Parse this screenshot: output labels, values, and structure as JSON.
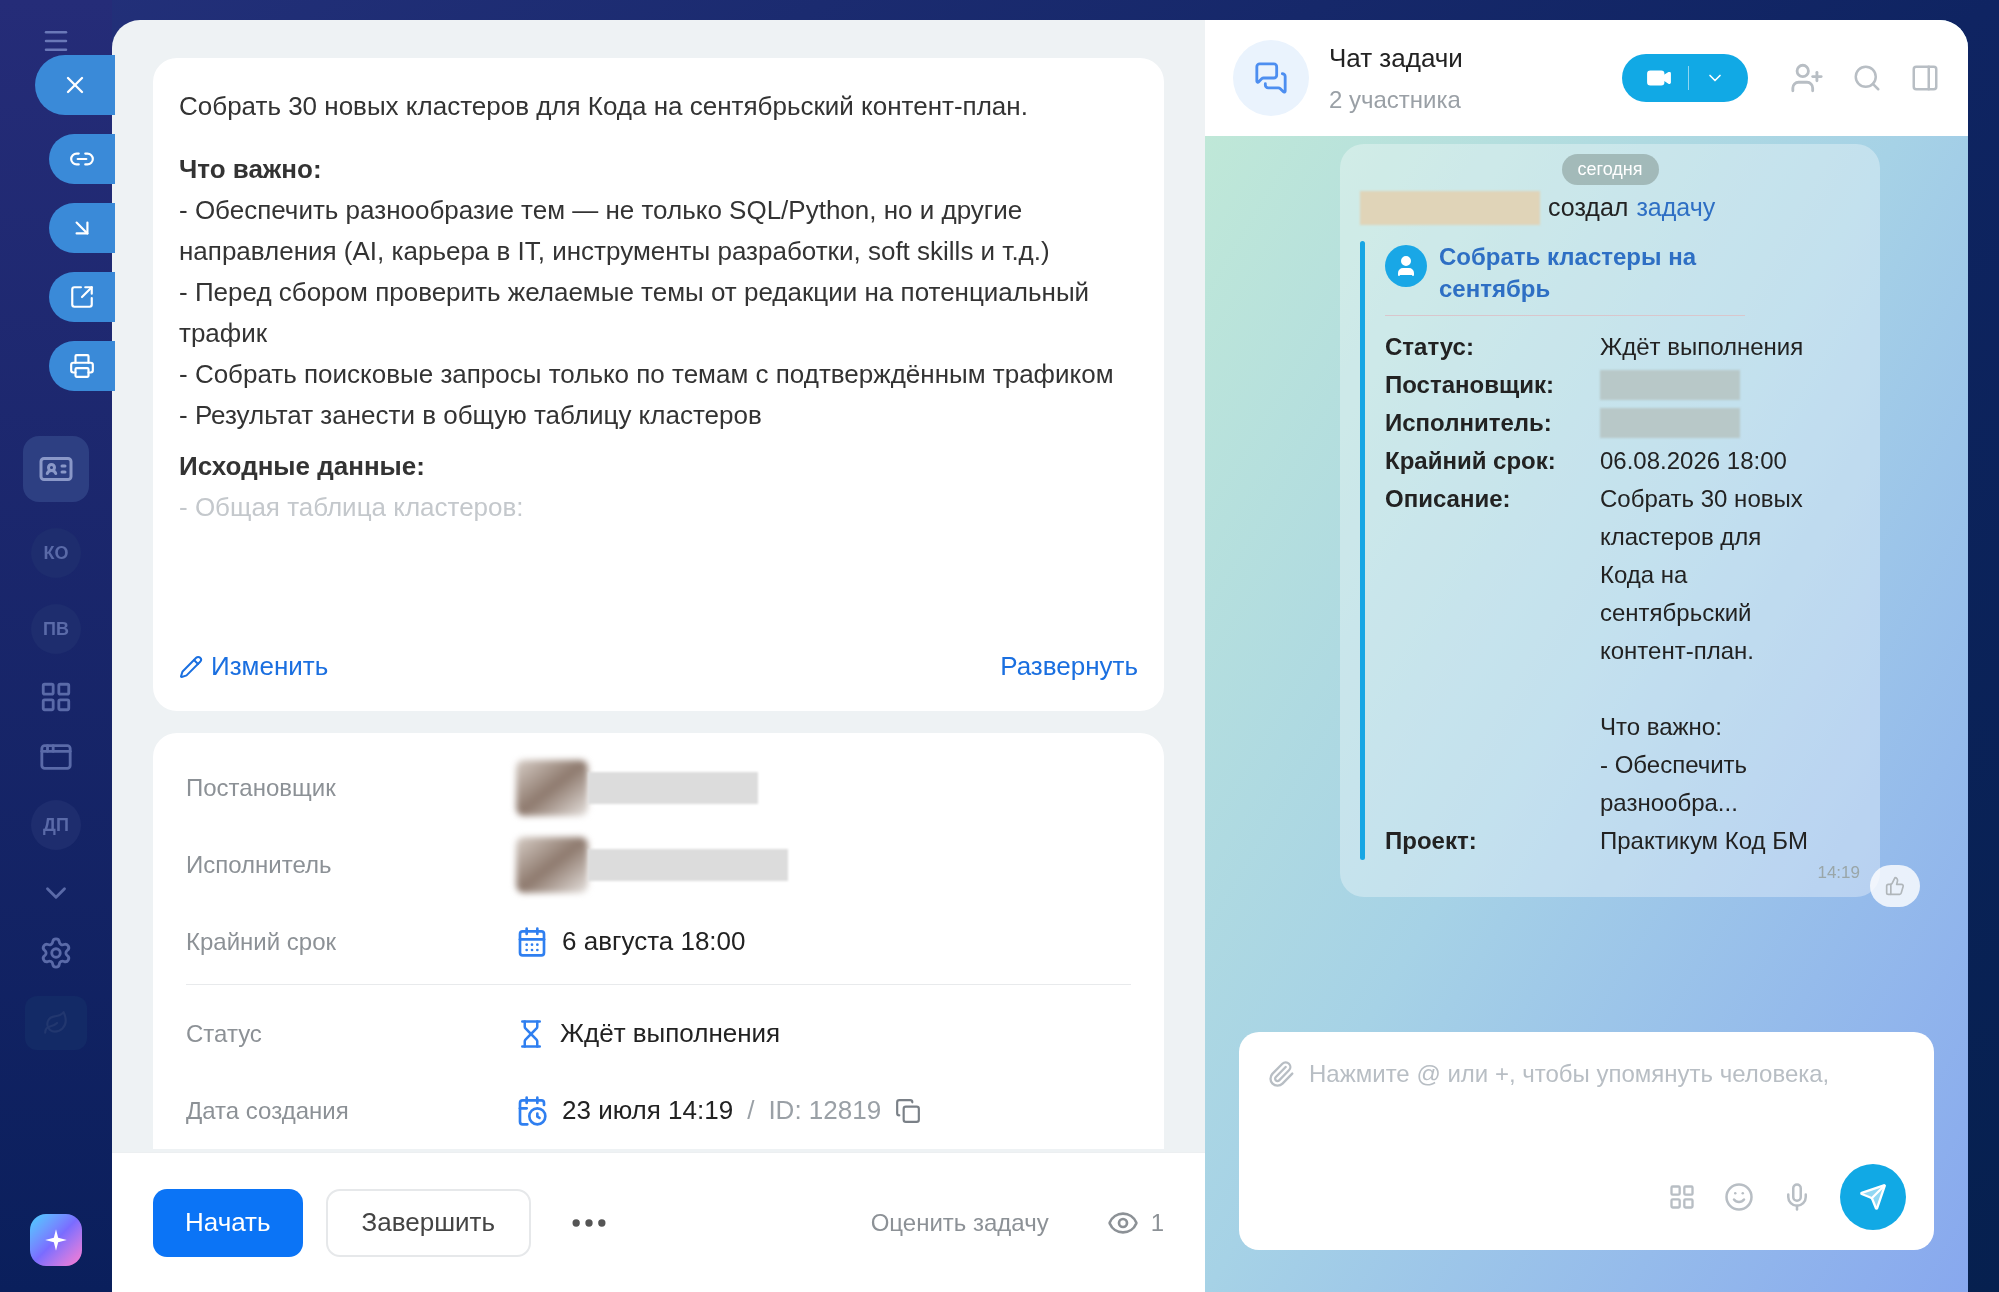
{
  "sidebar": {
    "items": [
      {
        "kind": "card"
      },
      {
        "kind": "initials",
        "label": "КО"
      },
      {
        "kind": "initials",
        "label": "ПВ"
      },
      {
        "kind": "grid"
      },
      {
        "kind": "window"
      },
      {
        "kind": "initials",
        "label": "ДП"
      },
      {
        "kind": "chevron"
      },
      {
        "kind": "gear"
      },
      {
        "kind": "tile"
      }
    ]
  },
  "task": {
    "description": {
      "blocks": [
        {
          "kind": "paragraph",
          "text": "Собрать 30 новых кластеров для Кода на сентябрьский контент-план."
        },
        {
          "kind": "heading",
          "text": "Что важно:"
        },
        {
          "kind": "line",
          "text": "- Обеспечить разнообразие тем — не только SQL/Python, но и другие направления (AI, карьера в IT, инструменты разработки, soft skills и т.д.)"
        },
        {
          "kind": "line",
          "text": "- Перед сбором проверить желаемые темы от редакции на потенциальный трафик"
        },
        {
          "kind": "line",
          "text": "- Собрать поисковые запросы только по темам с подтверждённым трафиком"
        },
        {
          "kind": "line",
          "text": "- Результат занести в общую таблицу кластеров"
        },
        {
          "kind": "heading",
          "text": "Исходные данные:"
        },
        {
          "kind": "faded",
          "text": "- Общая таблица кластеров:"
        }
      ],
      "edit": "Изменить",
      "expand": "Развернуть"
    },
    "details": {
      "sections": [
        [
          {
            "kind": "person",
            "label": "Постановщик"
          },
          {
            "kind": "person",
            "label": "Исполнитель"
          },
          {
            "kind": "deadline",
            "label": "Крайний срок",
            "value": "6 августа 18:00"
          }
        ],
        [
          {
            "kind": "status",
            "label": "Статус",
            "value": "Ждёт выполнения"
          },
          {
            "kind": "created",
            "label": "Дата создания",
            "value": "23 июля 14:19",
            "separator": "/",
            "id": "ID: 12819"
          }
        ]
      ]
    },
    "footer": {
      "start": "Начать",
      "finish": "Завершить",
      "rate": "Оценить задачу",
      "views": "1"
    }
  },
  "chat": {
    "title": "Чат задачи",
    "subtitle": "2 участника",
    "message": {
      "date_pill": "сегодня",
      "action": "создал",
      "action_link": "задачу",
      "task_title": "Собрать кластеры на сентябрь",
      "fields": [
        {
          "kind": "text",
          "label": "Статус:",
          "value": "Ждёт выполнения"
        },
        {
          "kind": "hidden",
          "label": "Постановщик:"
        },
        {
          "kind": "hidden",
          "label": "Исполнитель:"
        },
        {
          "kind": "text",
          "label": "Крайний срок:",
          "value": "06.08.2026 18:00"
        },
        {
          "kind": "text",
          "label": "Описание:",
          "value": "Собрать 30 новых кластеров для Кода на сентябрьский контент-план.\n\nЧто важно:\n- Обеспечить разнообра..."
        },
        {
          "kind": "text",
          "label": "Проект:",
          "value": "Практикум Код БМ"
        }
      ],
      "time": "14:19"
    },
    "composer": {
      "placeholder": "Нажмите @ или +, чтобы упомянуть человека,"
    }
  }
}
